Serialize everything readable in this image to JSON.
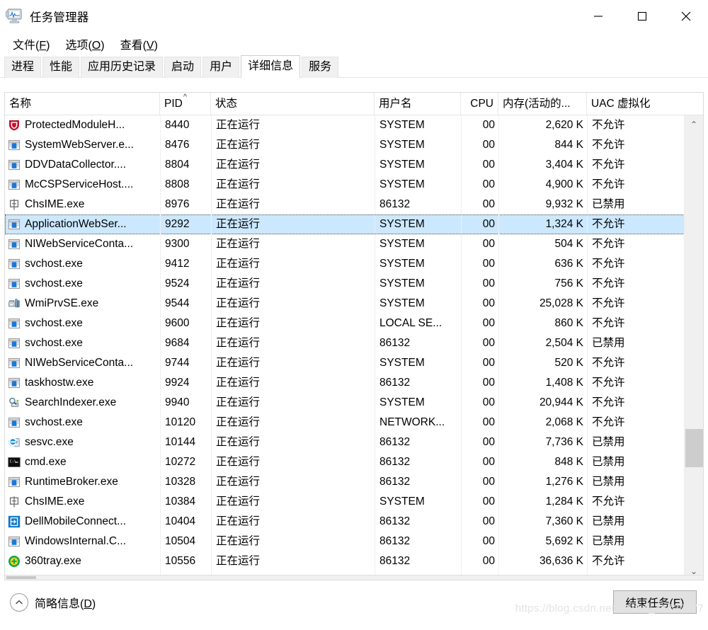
{
  "window": {
    "title": "任务管理器",
    "icon": "task-manager-icon",
    "controls": {
      "minimize": "最小化",
      "maximize": "最大化",
      "close": "关闭"
    }
  },
  "menubar": {
    "items": [
      {
        "label": "文件(F)",
        "text": "文件(",
        "accel": "F",
        "tail": ")"
      },
      {
        "label": "选项(O)",
        "text": "选项(",
        "accel": "O",
        "tail": ")"
      },
      {
        "label": "查看(V)",
        "text": "查看(",
        "accel": "V",
        "tail": ")"
      }
    ]
  },
  "tabs": {
    "active": "详细信息",
    "items": [
      {
        "label": "进程"
      },
      {
        "label": "性能"
      },
      {
        "label": "应用历史记录"
      },
      {
        "label": "启动"
      },
      {
        "label": "用户"
      },
      {
        "label": "详细信息"
      },
      {
        "label": "服务"
      }
    ]
  },
  "table": {
    "columns": [
      {
        "key": "name",
        "label": "名称",
        "align": "left"
      },
      {
        "key": "pid",
        "label": "PID",
        "align": "left",
        "sort": "asc",
        "sort_glyph": "^"
      },
      {
        "key": "state",
        "label": "状态",
        "align": "left"
      },
      {
        "key": "user",
        "label": "用户名",
        "align": "left"
      },
      {
        "key": "cpu",
        "label": "CPU",
        "align": "right"
      },
      {
        "key": "mem",
        "label": "内存(活动的...",
        "align": "right"
      },
      {
        "key": "uac",
        "label": "UAC 虚拟化",
        "align": "left"
      }
    ],
    "selected_index": 5,
    "rows": [
      {
        "icon": "mcafee-shield-icon",
        "name": "ProtectedModuleH...",
        "pid": "8440",
        "state": "正在运行",
        "user": "SYSTEM",
        "cpu": "00",
        "mem": "2,620 K",
        "uac": "不允许"
      },
      {
        "icon": "generic-window-icon",
        "name": "SystemWebServer.e...",
        "pid": "8476",
        "state": "正在运行",
        "user": "SYSTEM",
        "cpu": "00",
        "mem": "844 K",
        "uac": "不允许"
      },
      {
        "icon": "generic-window-icon",
        "name": "DDVDataCollector....",
        "pid": "8804",
        "state": "正在运行",
        "user": "SYSTEM",
        "cpu": "00",
        "mem": "3,404 K",
        "uac": "不允许"
      },
      {
        "icon": "generic-window-icon",
        "name": "McCSPServiceHost....",
        "pid": "8808",
        "state": "正在运行",
        "user": "SYSTEM",
        "cpu": "00",
        "mem": "4,900 K",
        "uac": "不允许"
      },
      {
        "icon": "ime-icon",
        "name": "ChsIME.exe",
        "pid": "8976",
        "state": "正在运行",
        "user": "86132",
        "cpu": "00",
        "mem": "9,932 K",
        "uac": "已禁用"
      },
      {
        "icon": "generic-window-icon",
        "name": "ApplicationWebSer...",
        "pid": "9292",
        "state": "正在运行",
        "user": "SYSTEM",
        "cpu": "00",
        "mem": "1,324 K",
        "uac": "不允许"
      },
      {
        "icon": "generic-window-icon",
        "name": "NIWebServiceConta...",
        "pid": "9300",
        "state": "正在运行",
        "user": "SYSTEM",
        "cpu": "00",
        "mem": "504 K",
        "uac": "不允许"
      },
      {
        "icon": "generic-window-icon",
        "name": "svchost.exe",
        "pid": "9412",
        "state": "正在运行",
        "user": "SYSTEM",
        "cpu": "00",
        "mem": "636 K",
        "uac": "不允许"
      },
      {
        "icon": "generic-window-icon",
        "name": "svchost.exe",
        "pid": "9524",
        "state": "正在运行",
        "user": "SYSTEM",
        "cpu": "00",
        "mem": "756 K",
        "uac": "不允许"
      },
      {
        "icon": "wmi-icon",
        "name": "WmiPrvSE.exe",
        "pid": "9544",
        "state": "正在运行",
        "user": "SYSTEM",
        "cpu": "00",
        "mem": "25,028 K",
        "uac": "不允许"
      },
      {
        "icon": "generic-window-icon",
        "name": "svchost.exe",
        "pid": "9600",
        "state": "正在运行",
        "user": "LOCAL SE...",
        "cpu": "00",
        "mem": "860 K",
        "uac": "不允许"
      },
      {
        "icon": "generic-window-icon",
        "name": "svchost.exe",
        "pid": "9684",
        "state": "正在运行",
        "user": "86132",
        "cpu": "00",
        "mem": "2,504 K",
        "uac": "已禁用"
      },
      {
        "icon": "generic-window-icon",
        "name": "NIWebServiceConta...",
        "pid": "9744",
        "state": "正在运行",
        "user": "SYSTEM",
        "cpu": "00",
        "mem": "520 K",
        "uac": "不允许"
      },
      {
        "icon": "generic-window-icon",
        "name": "taskhostw.exe",
        "pid": "9924",
        "state": "正在运行",
        "user": "86132",
        "cpu": "00",
        "mem": "1,408 K",
        "uac": "不允许"
      },
      {
        "icon": "search-indexer-icon",
        "name": "SearchIndexer.exe",
        "pid": "9940",
        "state": "正在运行",
        "user": "SYSTEM",
        "cpu": "00",
        "mem": "20,944 K",
        "uac": "不允许"
      },
      {
        "icon": "generic-window-icon",
        "name": "svchost.exe",
        "pid": "10120",
        "state": "正在运行",
        "user": "NETWORK...",
        "cpu": "00",
        "mem": "2,068 K",
        "uac": "不允许"
      },
      {
        "icon": "sesvc-icon",
        "name": "sesvc.exe",
        "pid": "10144",
        "state": "正在运行",
        "user": "86132",
        "cpu": "00",
        "mem": "7,736 K",
        "uac": "已禁用"
      },
      {
        "icon": "console-icon",
        "name": "cmd.exe",
        "pid": "10272",
        "state": "正在运行",
        "user": "86132",
        "cpu": "00",
        "mem": "848 K",
        "uac": "已禁用"
      },
      {
        "icon": "generic-window-icon",
        "name": "RuntimeBroker.exe",
        "pid": "10328",
        "state": "正在运行",
        "user": "86132",
        "cpu": "00",
        "mem": "1,276 K",
        "uac": "已禁用"
      },
      {
        "icon": "ime-icon",
        "name": "ChsIME.exe",
        "pid": "10384",
        "state": "正在运行",
        "user": "SYSTEM",
        "cpu": "00",
        "mem": "1,284 K",
        "uac": "不允许"
      },
      {
        "icon": "dell-mobile-icon",
        "name": "DellMobileConnect...",
        "pid": "10404",
        "state": "正在运行",
        "user": "86132",
        "cpu": "00",
        "mem": "7,360 K",
        "uac": "已禁用"
      },
      {
        "icon": "generic-window-icon",
        "name": "WindowsInternal.C...",
        "pid": "10504",
        "state": "正在运行",
        "user": "86132",
        "cpu": "00",
        "mem": "5,692 K",
        "uac": "已禁用"
      },
      {
        "icon": "360tray-icon",
        "name": "360tray.exe",
        "pid": "10556",
        "state": "正在运行",
        "user": "86132",
        "cpu": "00",
        "mem": "36,636 K",
        "uac": "不允许"
      }
    ]
  },
  "scrollbar": {
    "up_glyph": "⌃",
    "down_glyph": "⌄",
    "thumb_top_pct": 69,
    "thumb_height_pct": 9
  },
  "bottombar": {
    "fewer_details": {
      "text": "简略信息(",
      "accel": "D",
      "tail": ")",
      "icon": "chevron-up-circle-icon"
    },
    "end_task": {
      "text": "结束任务(",
      "accel": "E",
      "tail": ")"
    }
  },
  "watermark": "https://blog.csdn.net/weixin_45727777"
}
